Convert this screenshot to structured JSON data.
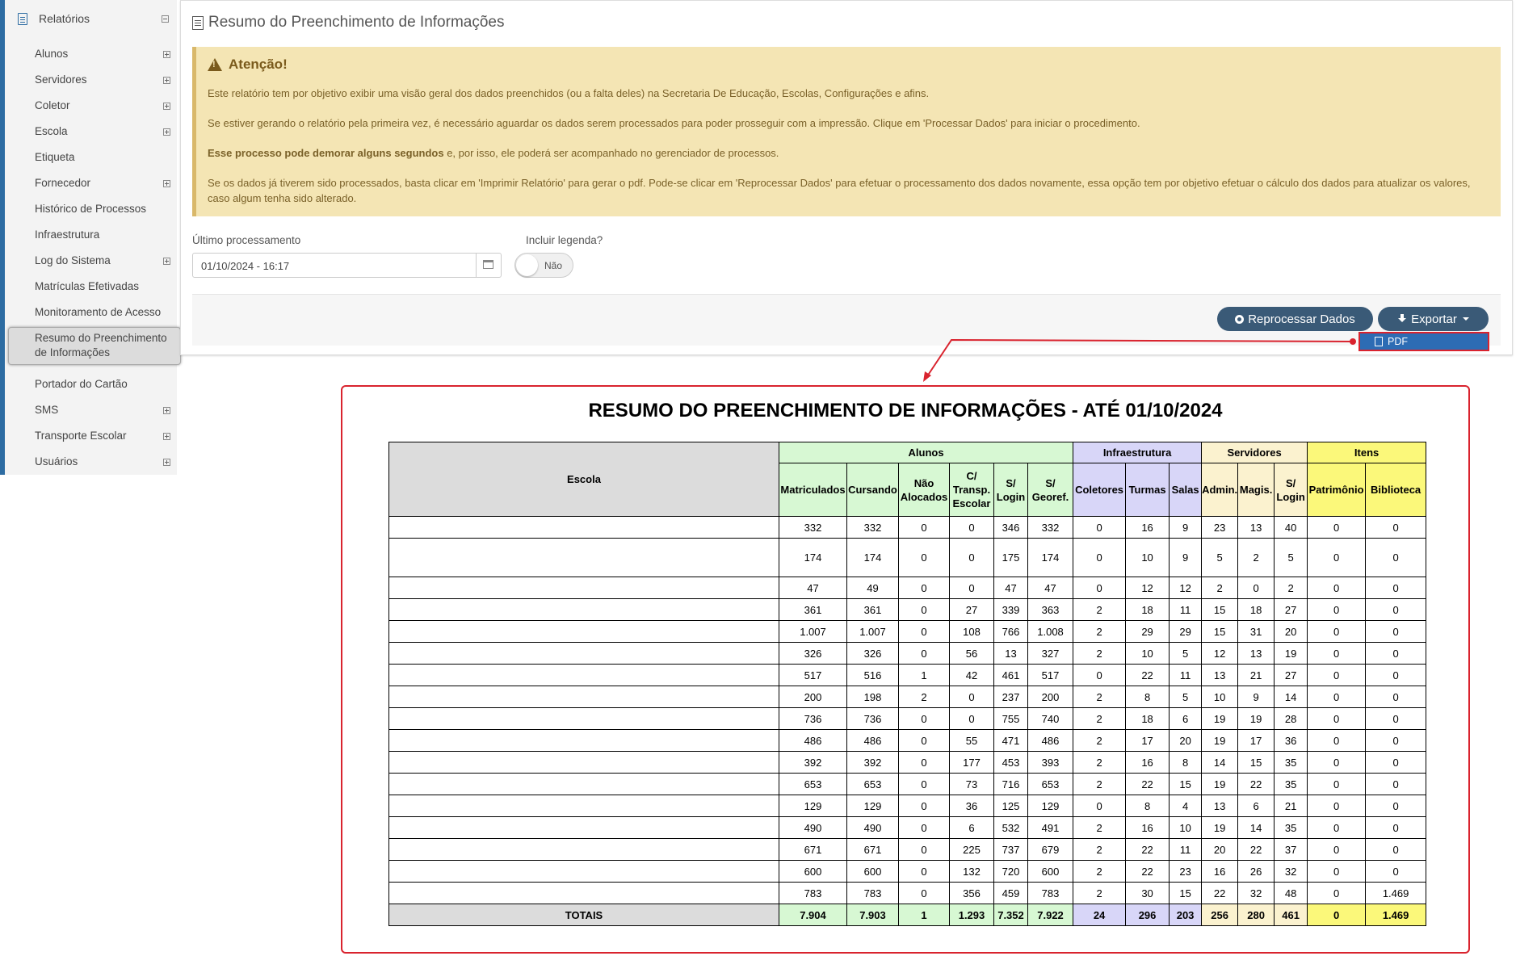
{
  "sidebar": {
    "header": "Relatórios",
    "items": [
      {
        "label": "Alunos",
        "expand": true
      },
      {
        "label": "Servidores",
        "expand": true
      },
      {
        "label": "Coletor",
        "expand": true
      },
      {
        "label": "Escola",
        "expand": true
      },
      {
        "label": "Etiqueta",
        "expand": false
      },
      {
        "label": "Fornecedor",
        "expand": true
      },
      {
        "label": "Histórico de Processos",
        "expand": false
      },
      {
        "label": "Infraestrutura",
        "expand": false
      },
      {
        "label": "Log do Sistema",
        "expand": true
      },
      {
        "label": "Matrículas Efetivadas",
        "expand": false
      },
      {
        "label": "Monitoramento de Acesso",
        "expand": false
      },
      {
        "label": "Resumo do Preenchimento de Informações",
        "expand": false
      },
      {
        "label": "Portador do Cartão",
        "expand": false
      },
      {
        "label": "SMS",
        "expand": true
      },
      {
        "label": "Transporte Escolar",
        "expand": true
      },
      {
        "label": "Usuários",
        "expand": true
      }
    ]
  },
  "page": {
    "title": "Resumo do Preenchimento de Informações"
  },
  "alert": {
    "title": "Atenção!",
    "p1": "Este relatório tem por objetivo exibir uma visão geral dos dados preenchidos (ou a falta deles) na Secretaria De Educação, Escolas, Configurações e afins.",
    "p2": "Se estiver gerando o relatório pela primeira vez, é necessário aguardar os dados serem processados para poder prosseguir com a impressão. Clique em 'Processar Dados' para iniciar o procedimento.",
    "p3_bold": "Esse processo pode demorar alguns segundos",
    "p3_rest": " e, por isso, ele poderá ser acompanhado no gerenciador de processos.",
    "p4": "Se os dados já tiverem sido processados, basta clicar em 'Imprimir Relatório' para gerar o pdf. Pode-se clicar em 'Reprocessar Dados' para efetuar o processamento dos dados novamente, essa opção tem por objetivo efetuar o cálculo dos dados para atualizar os valores, caso algum tenha sido alterado."
  },
  "form": {
    "last_processing_label": "Último processamento",
    "last_processing_value": "01/10/2024 - 16:17",
    "legend_label": "Incluir legenda?",
    "legend_toggle": "Não"
  },
  "actions": {
    "reprocess": "Reprocessar Dados",
    "export": "Exportar",
    "pdf": "PDF"
  },
  "report": {
    "title": "RESUMO DO PREENCHIMENTO DE INFORMAÇÕES - ATÉ 01/10/2024",
    "escola_header": "Escola",
    "groups": [
      "Alunos",
      "Infraestrutura",
      "Servidores",
      "Itens"
    ],
    "columns": [
      "Matriculados",
      "Cursando",
      "Não Alocados",
      "C/ Transp. Escolar",
      "S/ Login",
      "S/ Georef.",
      "Coletores",
      "Turmas",
      "Salas",
      "Admin.",
      "Magis.",
      "S/ Login",
      "Patrimônio",
      "Biblioteca"
    ],
    "rows": [
      [
        "332",
        "332",
        "0",
        "0",
        "346",
        "332",
        "0",
        "16",
        "9",
        "23",
        "13",
        "40",
        "0",
        "0"
      ],
      [
        "174",
        "174",
        "0",
        "0",
        "175",
        "174",
        "0",
        "10",
        "9",
        "5",
        "2",
        "5",
        "0",
        "0"
      ],
      [
        "47",
        "49",
        "0",
        "0",
        "47",
        "47",
        "0",
        "12",
        "12",
        "2",
        "0",
        "2",
        "0",
        "0"
      ],
      [
        "361",
        "361",
        "0",
        "27",
        "339",
        "363",
        "2",
        "18",
        "11",
        "15",
        "18",
        "27",
        "0",
        "0"
      ],
      [
        "1.007",
        "1.007",
        "0",
        "108",
        "766",
        "1.008",
        "2",
        "29",
        "29",
        "15",
        "31",
        "20",
        "0",
        "0"
      ],
      [
        "326",
        "326",
        "0",
        "56",
        "13",
        "327",
        "2",
        "10",
        "5",
        "12",
        "13",
        "19",
        "0",
        "0"
      ],
      [
        "517",
        "516",
        "1",
        "42",
        "461",
        "517",
        "0",
        "22",
        "11",
        "13",
        "21",
        "27",
        "0",
        "0"
      ],
      [
        "200",
        "198",
        "2",
        "0",
        "237",
        "200",
        "2",
        "8",
        "5",
        "10",
        "9",
        "14",
        "0",
        "0"
      ],
      [
        "736",
        "736",
        "0",
        "0",
        "755",
        "740",
        "2",
        "18",
        "6",
        "19",
        "19",
        "28",
        "0",
        "0"
      ],
      [
        "486",
        "486",
        "0",
        "55",
        "471",
        "486",
        "2",
        "17",
        "20",
        "19",
        "17",
        "36",
        "0",
        "0"
      ],
      [
        "392",
        "392",
        "0",
        "177",
        "453",
        "393",
        "2",
        "16",
        "8",
        "14",
        "15",
        "35",
        "0",
        "0"
      ],
      [
        "653",
        "653",
        "0",
        "73",
        "716",
        "653",
        "2",
        "22",
        "15",
        "19",
        "22",
        "35",
        "0",
        "0"
      ],
      [
        "129",
        "129",
        "0",
        "36",
        "125",
        "129",
        "0",
        "8",
        "4",
        "13",
        "6",
        "21",
        "0",
        "0"
      ],
      [
        "490",
        "490",
        "0",
        "6",
        "532",
        "491",
        "2",
        "16",
        "10",
        "19",
        "14",
        "35",
        "0",
        "0"
      ],
      [
        "671",
        "671",
        "0",
        "225",
        "737",
        "679",
        "2",
        "22",
        "11",
        "20",
        "22",
        "37",
        "0",
        "0"
      ],
      [
        "600",
        "600",
        "0",
        "132",
        "720",
        "600",
        "2",
        "22",
        "23",
        "16",
        "26",
        "32",
        "0",
        "0"
      ],
      [
        "783",
        "783",
        "0",
        "356",
        "459",
        "783",
        "2",
        "30",
        "15",
        "22",
        "32",
        "48",
        "0",
        "1.469"
      ]
    ],
    "totals_label": "TOTAIS",
    "totals": [
      "7.904",
      "7.903",
      "1",
      "1.293",
      "7.352",
      "7.922",
      "24",
      "296",
      "203",
      "256",
      "280",
      "461",
      "0",
      "1.469"
    ]
  }
}
